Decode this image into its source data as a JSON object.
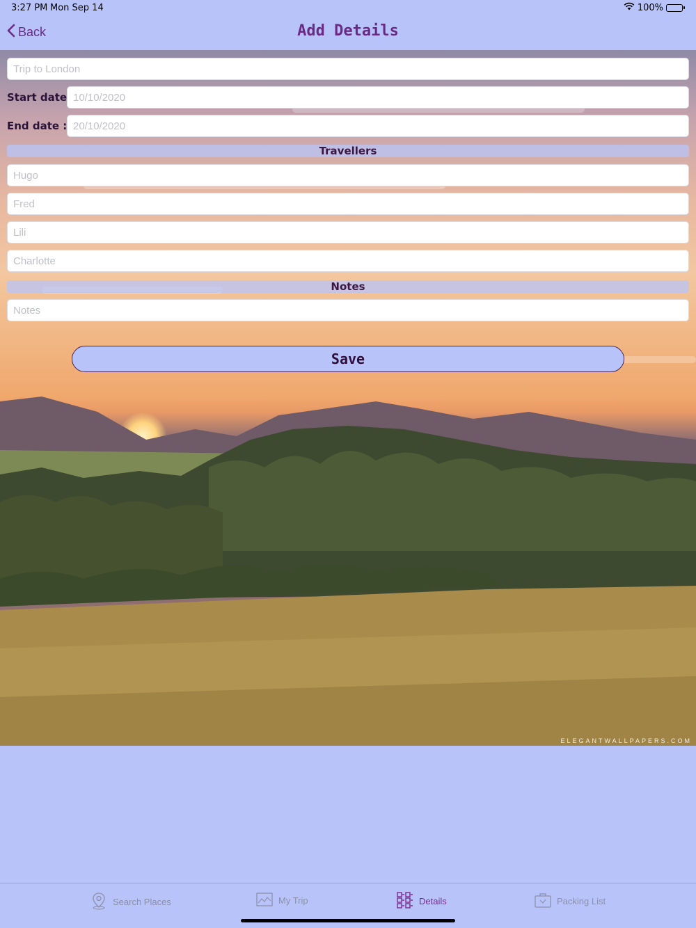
{
  "status": {
    "time": "3:27 PM",
    "date": "Mon Sep 14",
    "battery": "100%"
  },
  "nav": {
    "back_label": "Back",
    "title": "Add Details"
  },
  "form": {
    "trip_name_placeholder": "Trip to London",
    "start_label": "Start date :",
    "start_placeholder": "10/10/2020",
    "end_label": "End date :",
    "end_placeholder": "20/10/2020",
    "travellers_header": "Travellers",
    "travellers": [
      "Hugo",
      "Fred",
      "Lili",
      "Charlotte"
    ],
    "notes_header": "Notes",
    "notes_placeholder": "Notes"
  },
  "save_label": "Save",
  "watermark": "ELEGANTWALLPAPERS.COM",
  "tabs": [
    {
      "label": "Search Places",
      "icon": "map-pin-icon",
      "active": false
    },
    {
      "label": "My Trip",
      "icon": "map-icon",
      "active": false
    },
    {
      "label": "Details",
      "icon": "grid-list-icon",
      "active": true
    },
    {
      "label": "Packing List",
      "icon": "suitcase-icon",
      "active": false
    }
  ],
  "colors": {
    "bar_background": "#b8c4f9",
    "accent": "#6a2a84",
    "tab_inactive": "#8c8fa8"
  }
}
